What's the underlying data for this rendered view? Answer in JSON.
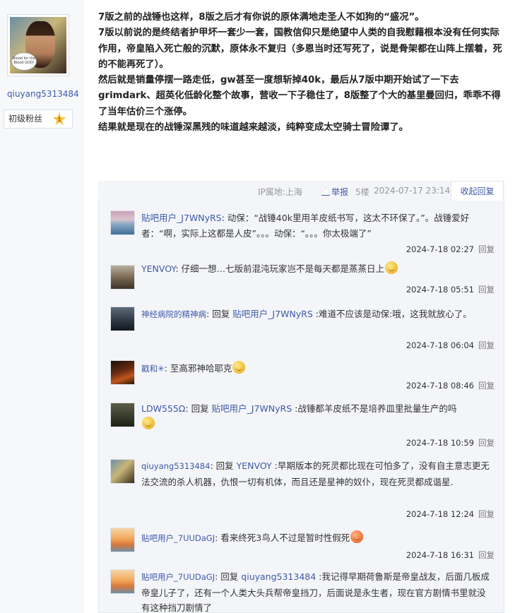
{
  "author": {
    "name": "qiuyang5313484",
    "fan_level": "初级粉丝",
    "fan_level_num": "1",
    "avatar_caption": "Blood for the Blood GOD!"
  },
  "post": {
    "paragraphs": [
      "7版之前的战锤也这样，8版之后才有你说的原体满地走圣人不如狗的“盛况”。",
      "7版以前说的是终结者护甲坏一套少一套，国教信仰只是绝望中人类的自我慰藉根本没有任何实际作用，帝皇陷入死亡般的沉默，原体永不复归（多恩当时还写死了，说是骨架都在山阵上摆着，死的不能再死了）。",
      "然后就是销量停摆一路走低，gw甚至一度想斩掉40k，最后从7版中期开始试了一下去grimdark、超英化低龄化整个故事，营收一下子稳住了，8版整了个大的基里曼回归，乖乖不得了当年估价三个涨停。",
      "结果就是现在的战锤深黑残的味道越来越淡，纯粹变成太空骑士冒险谭了。"
    ],
    "meta": {
      "ip": "IP属地:上海",
      "report": "举报",
      "floor": "5楼",
      "time": "2024-07-17 23:14",
      "collapse": "收起回复"
    }
  },
  "replies": [
    {
      "user": "贴吧用户_J7WNyRS",
      "sep": ":",
      "reply_to": "",
      "text": " 动保：“战锤40k里用羊皮纸书写，这太不环保了。”。战锤爱好者：“啊，实际上这都是人皮”。。。动保：“。。。你太极端了”",
      "time": "2024-7-18 02:27",
      "reply_label": "回复"
    },
    {
      "user": "YENVOY",
      "sep": ":",
      "reply_to": "",
      "text": " 仔细一想…七版前混沌玩家岂不是每天都是蒸蒸日上",
      "time": "2024-7-18 05:51",
      "reply_label": "回复"
    },
    {
      "user": "神经病院的精神病",
      "sep": ":",
      "reply_prefix": " 回复 ",
      "reply_to": "贴吧用户_J7WNyRS",
      "text": " :难道不应该是动保:哦，这我就放心了。",
      "time": "2024-7-18 06:04",
      "reply_label": "回复"
    },
    {
      "user": "戳和✳",
      "sep": ":",
      "reply_to": "",
      "text": " 至高邪神哈耶克",
      "time": "2024-7-18 08:46",
      "reply_label": "回复"
    },
    {
      "user": "LDW555Ω",
      "sep": ":",
      "reply_prefix": " 回复 ",
      "reply_to": "贴吧用户_J7WNyRS",
      "text": " :战锤都羊皮纸不是培养皿里批量生产的吗",
      "time": "2024-7-18 10:59",
      "reply_label": "回复"
    },
    {
      "user": "qiuyang5313484",
      "sep": ":",
      "reply_prefix": " 回复 ",
      "reply_to": "YENVOY",
      "text": " :早期版本的死灵都比现在可怕多了，没有自主意志更无法交流的杀人机器，仇恨一切有机体，而且还是星神的奴仆，现在死灵都成谐星.",
      "time": "2024-7-18 12:24",
      "reply_label": "回复"
    },
    {
      "user": "贴吧用户_7UUDaGJ",
      "sep": ":",
      "reply_to": "",
      "text": " 看来终死3鸟人不过是暂时性假死",
      "time": "2024-7-18 16:31",
      "reply_label": "回复"
    },
    {
      "user": "贴吧用户_7UUDaGJ",
      "sep": ":",
      "reply_prefix": " 回复 ",
      "reply_to": "qiuyang5313484",
      "text": " :我记得早期荷鲁斯是帝皇战友，后面几板成帝皇儿子了，还有一个人类大头兵帮帝皇挡刀，后面说是永生者，现在官方剧情书里就没有这种挡刀剧情了",
      "time": "",
      "reply_label": ""
    }
  ]
}
